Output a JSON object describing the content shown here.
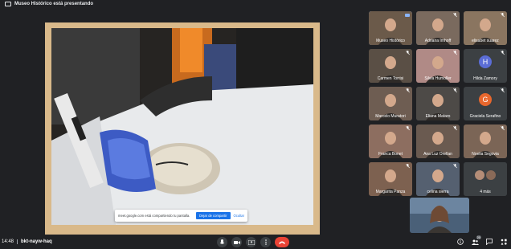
{
  "presenter_banner": "Museo Histórico está presentando",
  "share_bar": {
    "text": "meet.google.com está compartiendo tu pantalla.",
    "stop_label": "Dejar de compartir",
    "hide_label": "Ocultar"
  },
  "participants": [
    {
      "name": "Museo Histórico",
      "kind": "photo",
      "color": "#6b5a4a",
      "highlight": true
    },
    {
      "name": "Adriana Imhoff",
      "kind": "photo",
      "color": "#7a6a5e"
    },
    {
      "name": "elisabet suarez",
      "kind": "photo",
      "color": "#8a7560"
    },
    {
      "name": "Carmen Torrisi",
      "kind": "photo",
      "color": "#5a4f45"
    },
    {
      "name": "Silvia Humoller",
      "kind": "photo",
      "color": "#b08a86"
    },
    {
      "name": "Hilda Zamory",
      "kind": "initial",
      "initial": "H",
      "color": "#5b6dd6"
    },
    {
      "name": "Marcelo Muratori",
      "kind": "photo",
      "color": "#6e5d52"
    },
    {
      "name": "Eliana Mataro",
      "kind": "photo",
      "color": "#4d4a47"
    },
    {
      "name": "Graciela Serafino",
      "kind": "initial",
      "initial": "G",
      "color": "#e8672d"
    },
    {
      "name": "Franca Bonet",
      "kind": "photo",
      "color": "#8d6e60"
    },
    {
      "name": "Ana Luz Orellan",
      "kind": "photo",
      "color": "#6a5a50"
    },
    {
      "name": "Noelia Segovia",
      "kind": "photo",
      "color": "#7b6556"
    },
    {
      "name": "Margarita Panza",
      "kind": "photo",
      "color": "#7d6150"
    },
    {
      "name": "celina sierra",
      "kind": "photo",
      "color": "#556070"
    },
    {
      "name": "4 más",
      "kind": "more",
      "color": "#7a6a5e"
    }
  ],
  "self_view": {
    "kind": "photo",
    "color": "#4a6078"
  },
  "bottom": {
    "time": "14:48",
    "meeting_code": "bkt-nayw-haq",
    "participants_count": "20"
  }
}
